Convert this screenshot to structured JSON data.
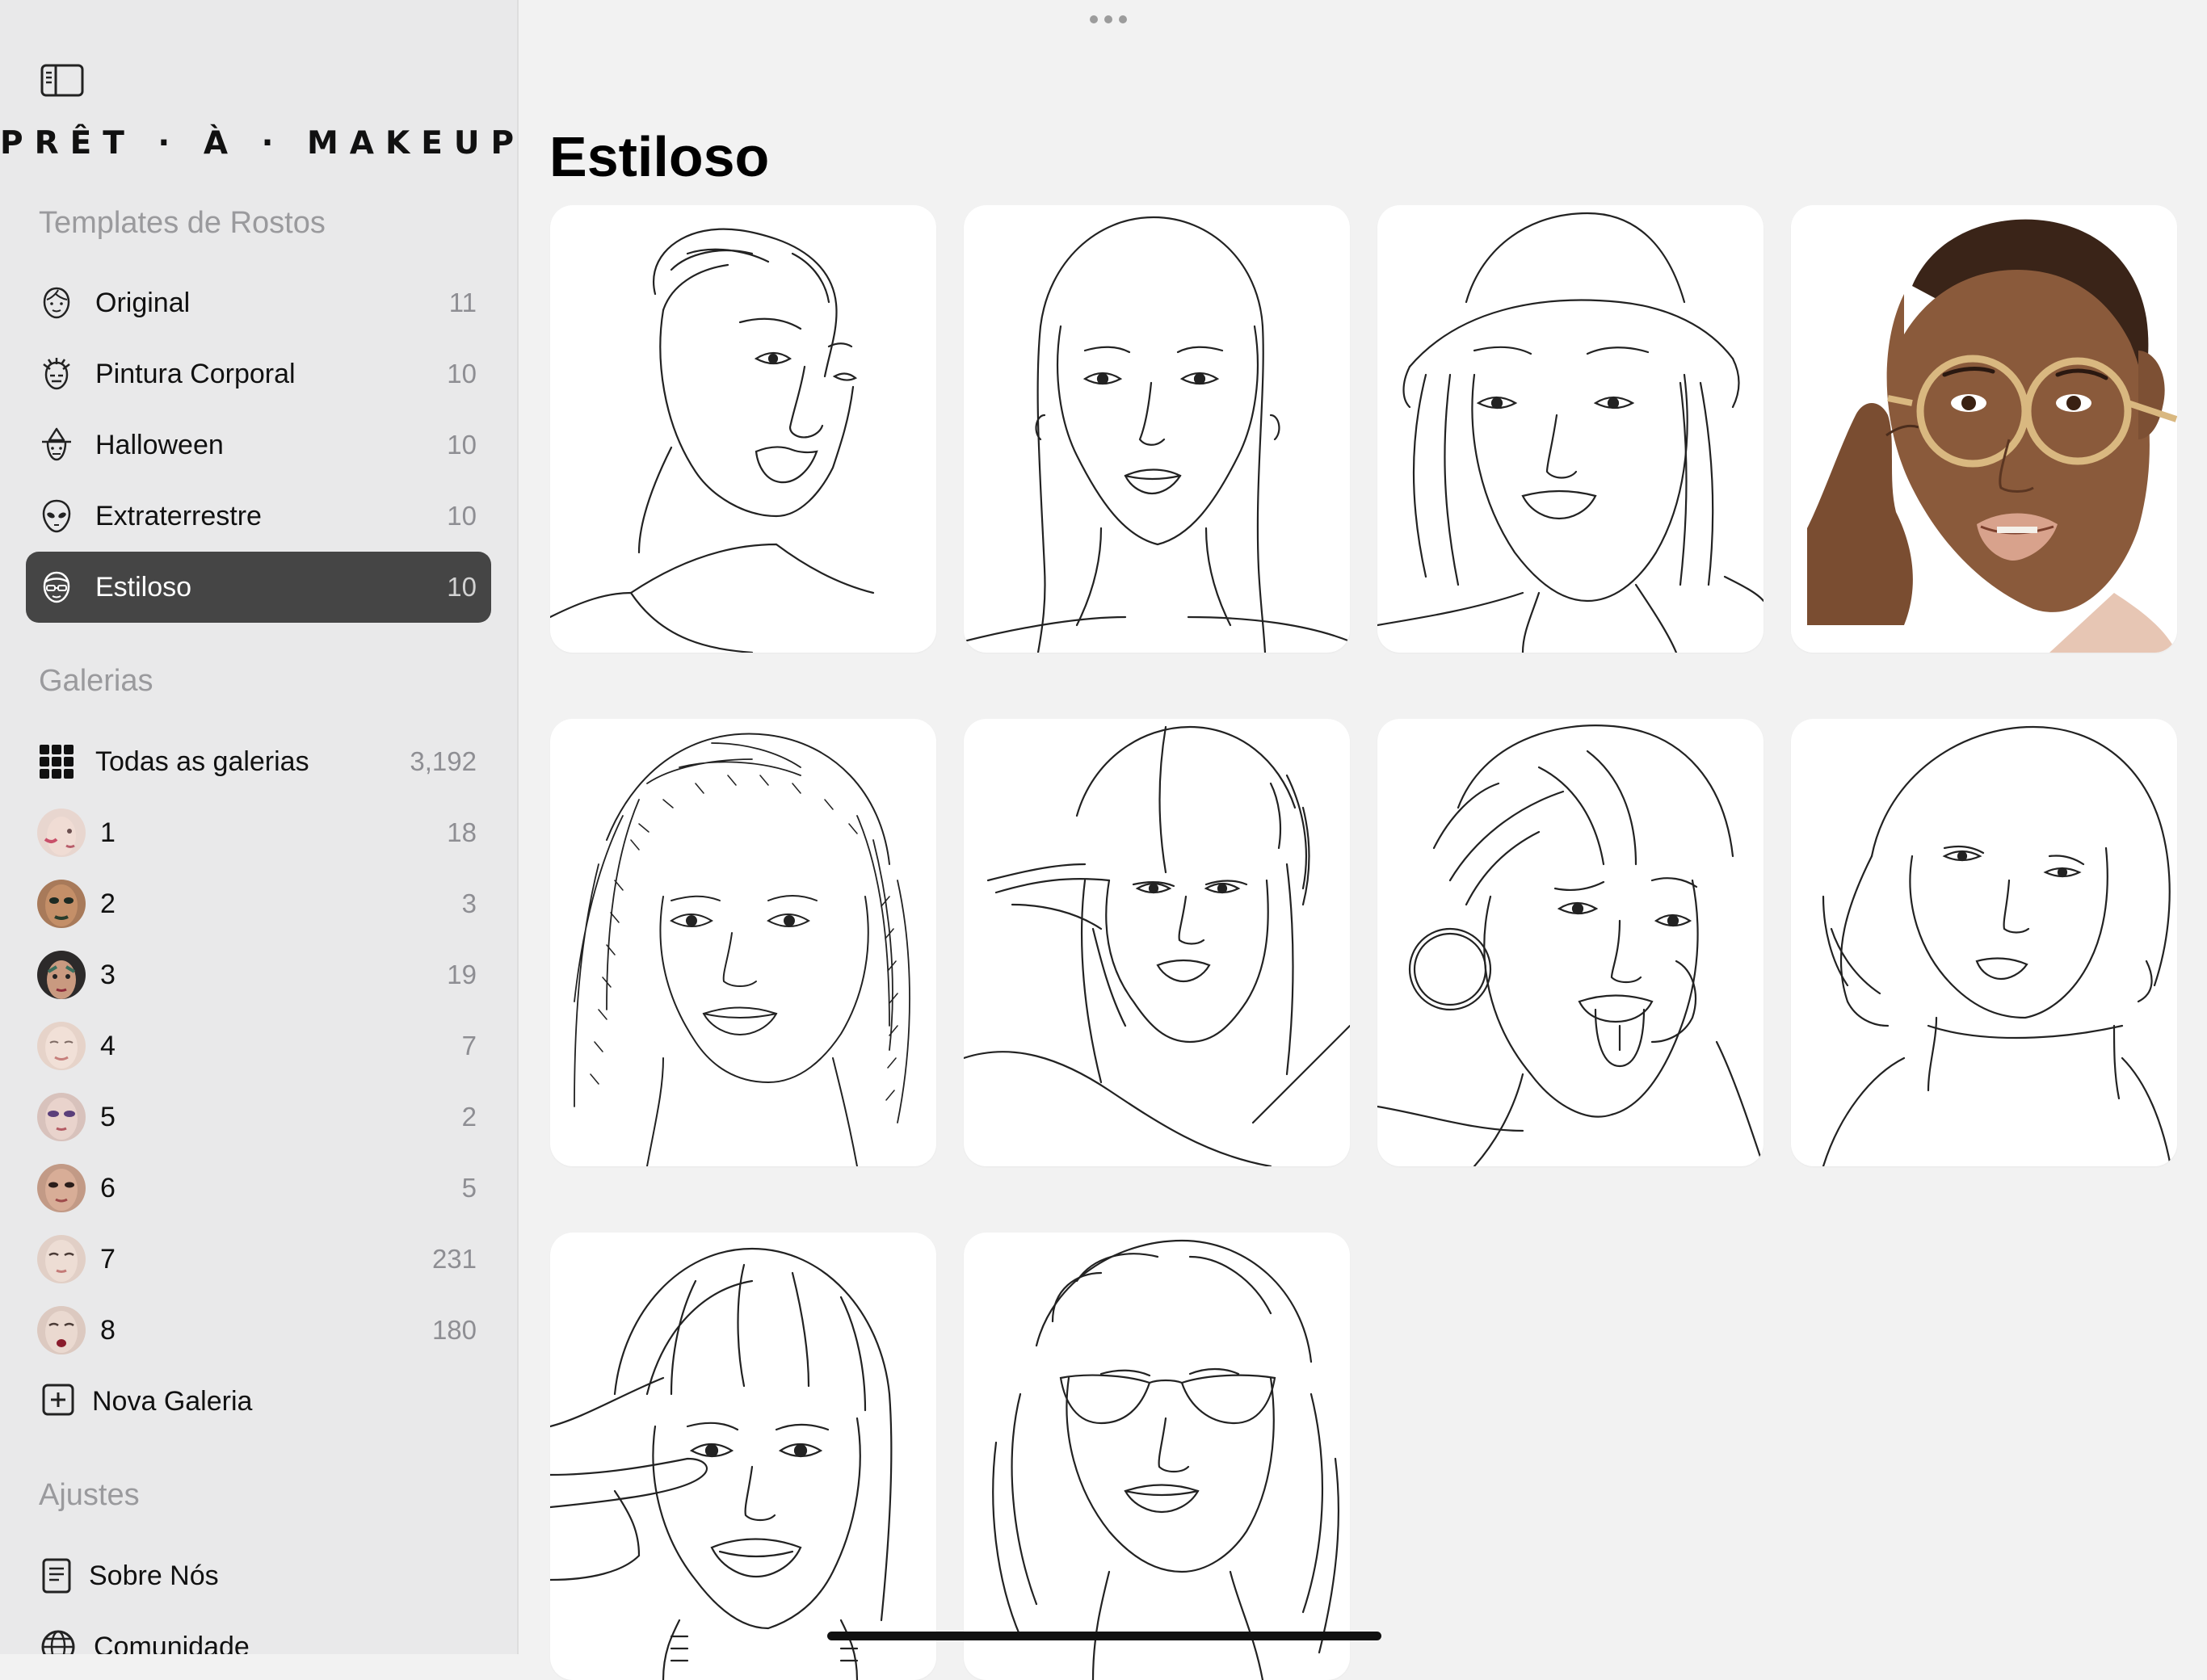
{
  "app": {
    "logo": "PRÊT · À · MAKEUP"
  },
  "sidebar": {
    "templates_title": "Templates de Rostos",
    "templates": [
      {
        "label": "Original",
        "count": "11",
        "icon": "face-outline-icon"
      },
      {
        "label": "Pintura Corporal",
        "count": "10",
        "icon": "body-paint-icon"
      },
      {
        "label": "Halloween",
        "count": "10",
        "icon": "witch-icon"
      },
      {
        "label": "Extraterrestre",
        "count": "10",
        "icon": "alien-icon"
      },
      {
        "label": "Estiloso",
        "count": "10",
        "icon": "stylish-face-icon",
        "active": true
      }
    ],
    "galleries_title": "Galerias",
    "all_galleries": {
      "label": "Todas as galerias",
      "count": "3,192",
      "icon": "grid-icon"
    },
    "galleries": [
      {
        "label": "1",
        "count": "18"
      },
      {
        "label": "2",
        "count": "3"
      },
      {
        "label": "3",
        "count": "19"
      },
      {
        "label": "4",
        "count": "7"
      },
      {
        "label": "5",
        "count": "2"
      },
      {
        "label": "6",
        "count": "5"
      },
      {
        "label": "7",
        "count": "231"
      },
      {
        "label": "8",
        "count": "180"
      }
    ],
    "new_gallery": {
      "label": "Nova Galeria",
      "icon": "plus-square-icon"
    },
    "settings_title": "Ajustes",
    "settings": [
      {
        "label": "Sobre Nós",
        "icon": "document-icon"
      },
      {
        "label": "Comunidade",
        "icon": "globe-icon"
      }
    ]
  },
  "main": {
    "title": "Estiloso",
    "templates": [
      {
        "name": "face-template-wavy-hair-man",
        "style": "line-art"
      },
      {
        "name": "face-template-long-straight-hair",
        "style": "line-art"
      },
      {
        "name": "face-template-bucket-hat",
        "style": "line-art"
      },
      {
        "name": "face-template-round-glasses",
        "style": "colored"
      },
      {
        "name": "face-template-braids",
        "style": "line-art"
      },
      {
        "name": "face-template-hands-in-hair",
        "style": "line-art"
      },
      {
        "name": "face-template-hoop-earring-tongue",
        "style": "line-art"
      },
      {
        "name": "face-template-bob-turtleneck",
        "style": "line-art"
      },
      {
        "name": "face-template-peace-sign",
        "style": "line-art"
      },
      {
        "name": "face-template-cat-eye-sunglasses",
        "style": "line-art"
      }
    ]
  },
  "colors": {
    "sidebar_bg": "#e9e9ea",
    "main_bg": "#f2f2f2",
    "active_item_bg": "#454545",
    "muted_text": "#9a9a9d"
  }
}
